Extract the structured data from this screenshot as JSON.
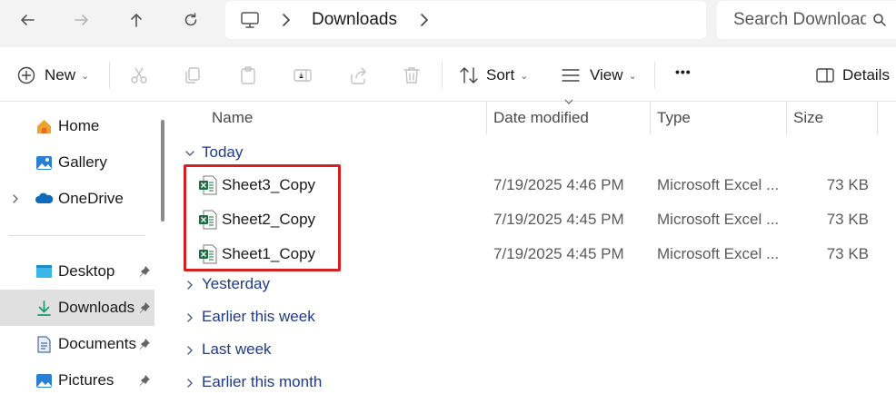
{
  "window": {
    "breadcrumb": {
      "current": "Downloads"
    },
    "search": {
      "placeholder": "Search Downloads"
    }
  },
  "toolbar": {
    "new_label": "New",
    "sort_label": "Sort",
    "view_label": "View",
    "more_label": "•••",
    "details_label": "Details"
  },
  "sidebar": {
    "items": [
      {
        "label": "Home",
        "icon": "home-icon"
      },
      {
        "label": "Gallery",
        "icon": "gallery-icon"
      },
      {
        "label": "OneDrive",
        "icon": "onedrive-icon"
      },
      {
        "label": "Desktop",
        "icon": "desktop-icon"
      },
      {
        "label": "Downloads",
        "icon": "downloads-icon",
        "selected": true
      },
      {
        "label": "Documents",
        "icon": "documents-icon"
      },
      {
        "label": "Pictures",
        "icon": "pictures-icon"
      }
    ]
  },
  "columns": {
    "name": "Name",
    "date": "Date modified",
    "type": "Type",
    "size": "Size"
  },
  "groups": {
    "today": "Today",
    "yesterday": "Yesterday",
    "earlier_week": "Earlier this week",
    "last_week": "Last week",
    "earlier_month": "Earlier this month"
  },
  "files": [
    {
      "name": "Sheet3_Copy",
      "date": "7/19/2025 4:46 PM",
      "type": "Microsoft Excel ...",
      "size": "73 KB"
    },
    {
      "name": "Sheet2_Copy",
      "date": "7/19/2025 4:45 PM",
      "type": "Microsoft Excel ...",
      "size": "73 KB"
    },
    {
      "name": "Sheet1_Copy",
      "date": "7/19/2025 4:45 PM",
      "type": "Microsoft Excel ...",
      "size": "73 KB"
    }
  ],
  "colors": {
    "highlight": "#d42020",
    "group_text": "#1f3a8a",
    "excel_green": "#1d6f42",
    "selected_bg": "#e0e0e0"
  }
}
